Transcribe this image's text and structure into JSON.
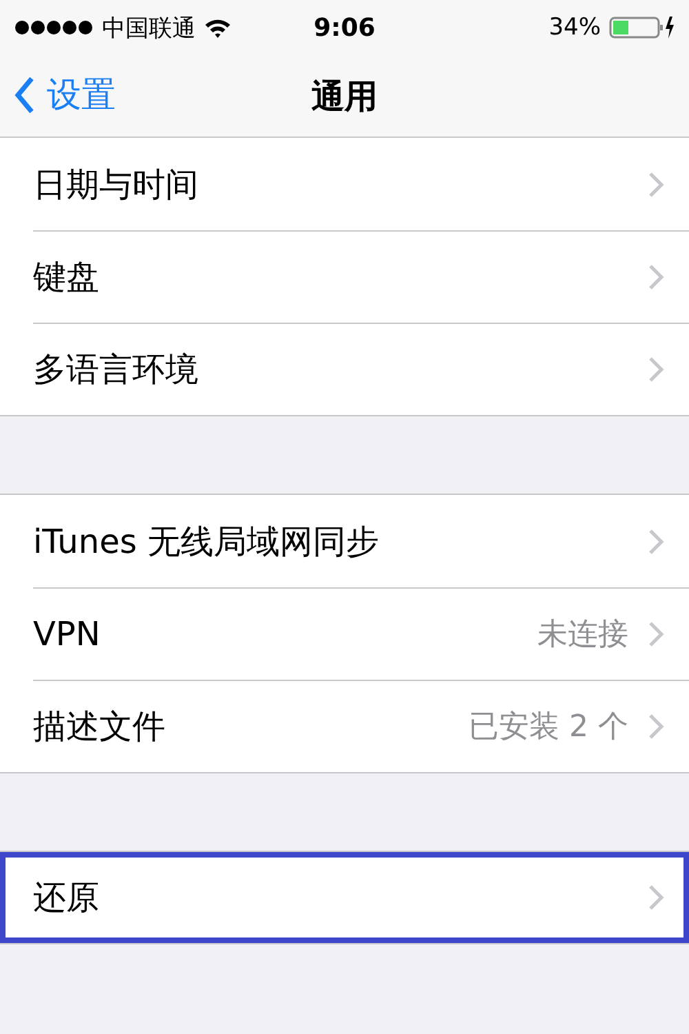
{
  "status_bar": {
    "carrier": "中国联通",
    "time": "9:06",
    "battery": "34%"
  },
  "nav": {
    "back": "设置",
    "title": "通用"
  },
  "sections": [
    {
      "rows": [
        {
          "label": "日期与时间",
          "highlighted": false
        },
        {
          "label": "键盘",
          "highlighted": false
        },
        {
          "label": "多语言环境",
          "highlighted": false
        }
      ]
    },
    {
      "rows": [
        {
          "label": "iTunes 无线局域网同步",
          "highlighted": false
        },
        {
          "label": "VPN",
          "value": "未连接",
          "highlighted": false
        },
        {
          "label": "描述文件",
          "value": "已安装 2 个",
          "highlighted": false
        }
      ]
    },
    {
      "rows": [
        {
          "label": "还原",
          "highlighted": true
        }
      ]
    }
  ]
}
